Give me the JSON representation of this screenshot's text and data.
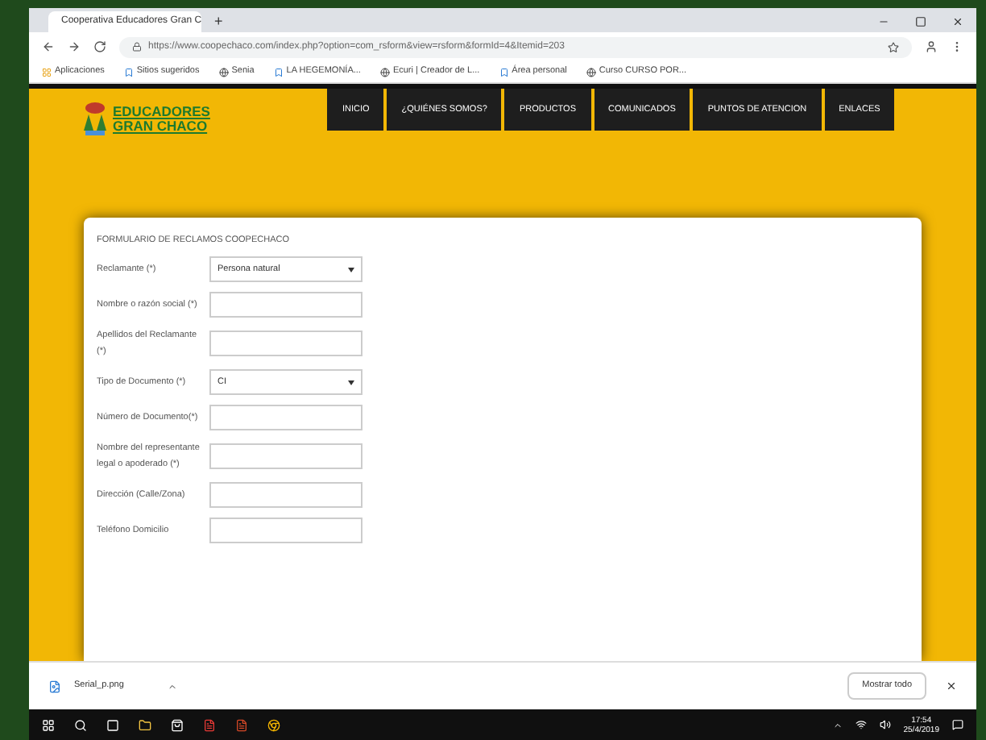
{
  "browser": {
    "tab_title": "Cooperativa Educadores Gran C",
    "new_tab": "+",
    "url": "https://www.coopechaco.com/index.php?option=com_rsform&view=rsform&formId=4&Itemid=203",
    "bookmarks": [
      "Aplicaciones",
      "Sitios sugeridos",
      "Senia",
      "LA HEGEMONÍA...",
      "Ecuri | Creador de L...",
      "Área personal",
      "Curso CURSO POR..."
    ]
  },
  "site": {
    "logo_lines": [
      "EDUCADORES",
      "GRAN CHACO"
    ],
    "nav": [
      {
        "label": "INICIO",
        "selected": false
      },
      {
        "label": "¿QUIÉNES SOMOS?",
        "selected": false
      },
      {
        "label": "PRODUCTOS",
        "selected": false
      },
      {
        "label": "COMUNICADOS",
        "selected": false
      },
      {
        "label": "PUNTOS DE ATENCION",
        "selected": false
      },
      {
        "label": "ENLACES",
        "selected": false
      }
    ]
  },
  "form": {
    "title": "FORMULARIO DE RECLAMOS COOPECHACO",
    "fields": [
      {
        "label": "Reclamante (*)",
        "kind": "select",
        "value": "Persona natural"
      },
      {
        "label": "Nombre o razón social (*)",
        "kind": "text"
      },
      {
        "label": "Apellidos del Reclamante (*)",
        "kind": "text"
      },
      {
        "label": "Tipo de Documento (*)",
        "kind": "select",
        "value": "CI"
      },
      {
        "label": "Número de Documento(*)",
        "kind": "text"
      },
      {
        "label": "Nombre del representante legal o apoderado (*)",
        "kind": "text"
      },
      {
        "label": "Dirección (Calle/Zona)",
        "kind": "text"
      },
      {
        "label": "Teléfono Domicilio",
        "kind": "text"
      }
    ]
  },
  "download_bar": {
    "file": "Serial_p.png",
    "show_all": "Mostrar todo"
  },
  "taskbar": {
    "time": "17:54",
    "date": "25/4/2019"
  }
}
